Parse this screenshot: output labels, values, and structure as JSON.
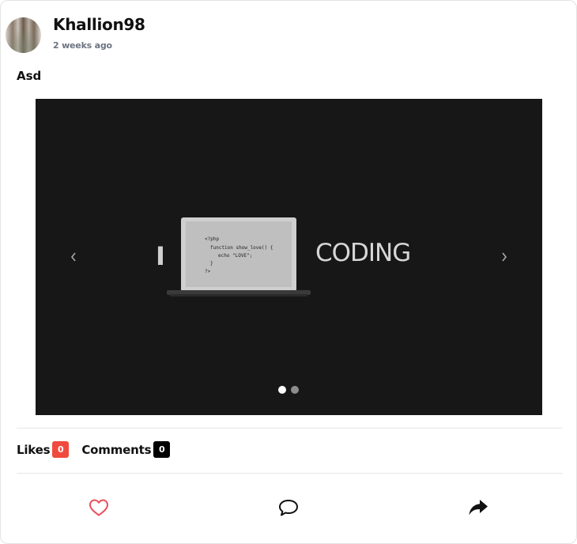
{
  "post": {
    "author": "Khallion98",
    "posted_ago": "2 weeks ago",
    "text": "Asd"
  },
  "carousel": {
    "slide_prefix": "I",
    "slide_word": "CODING",
    "code_lines": [
      "<?php",
      "function show_love() {",
      "echo \"LOVE\";",
      "}",
      "?>"
    ],
    "prev_icon": "chevron-left-icon",
    "next_icon": "chevron-right-icon",
    "slide_count": 2,
    "active_index": 0
  },
  "stats": {
    "likes_label": "Likes",
    "likes_count": "0",
    "comments_label": "Comments",
    "comments_count": "0"
  },
  "actions": {
    "like_icon": "heart-outline-icon",
    "comment_icon": "speech-bubble-icon",
    "share_icon": "share-arrow-icon"
  },
  "colors": {
    "likes_badge": "#f04a3e",
    "comments_badge": "#000000",
    "heart": "#e8505b",
    "carousel_bg": "#171717"
  }
}
